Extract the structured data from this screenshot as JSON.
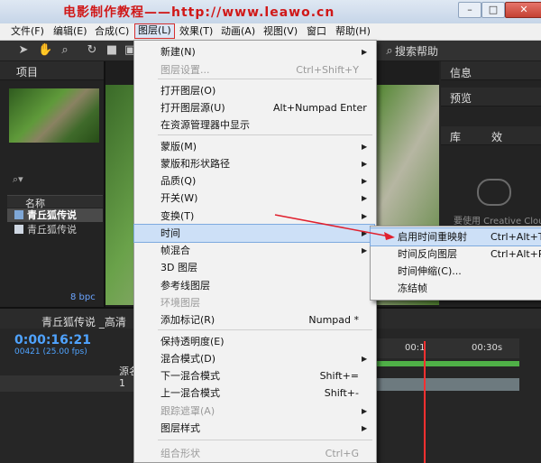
{
  "watermark": "电影制作教程——http://www.leawo.cn",
  "window_buttons": {
    "minimize": "–",
    "maximize": "□",
    "close": "✕"
  },
  "menubar": [
    "文件(F)",
    "编辑(E)",
    "合成(C)",
    "图层(L)",
    "效果(T)",
    "动画(A)",
    "视图(V)",
    "窗口",
    "帮助(H)"
  ],
  "toolbar": {
    "search_help": "搜索帮助"
  },
  "project_panel": {
    "tab": "项目",
    "column_name": "名称",
    "items": [
      "青丘狐传说",
      "青丘狐传说"
    ],
    "bpc": "8 bpc"
  },
  "right_panels": {
    "info": "信息",
    "preview": "预览",
    "library": "库",
    "effects": "效",
    "cc_text": "要使用 Creative Cloud"
  },
  "timeline": {
    "comp_tab": "青丘狐传说 _高清",
    "timecode": "0:00:16:21",
    "fps": "00421 (25.00 fps)",
    "col_source": "源名",
    "ruler_marks": [
      "00:1",
      "00:30s"
    ],
    "layer_index": "1"
  },
  "layer_menu": {
    "items": [
      {
        "label": "新建(N)",
        "shortcut": "",
        "submenu": true,
        "disabled": false
      },
      {
        "label": "图层设置...",
        "shortcut": "Ctrl+Shift+Y",
        "submenu": false,
        "disabled": true
      },
      {
        "label": "打开图层(O)",
        "shortcut": "",
        "submenu": false,
        "disabled": false
      },
      {
        "label": "打开图层源(U)",
        "shortcut": "Alt+Numpad Enter",
        "submenu": false,
        "disabled": false
      },
      {
        "label": "在资源管理器中显示",
        "shortcut": "",
        "submenu": false,
        "disabled": false
      },
      {
        "label": "蒙版(M)",
        "shortcut": "",
        "submenu": true,
        "disabled": false
      },
      {
        "label": "蒙版和形状路径",
        "shortcut": "",
        "submenu": true,
        "disabled": false
      },
      {
        "label": "品质(Q)",
        "shortcut": "",
        "submenu": true,
        "disabled": false
      },
      {
        "label": "开关(W)",
        "shortcut": "",
        "submenu": true,
        "disabled": false
      },
      {
        "label": "变换(T)",
        "shortcut": "",
        "submenu": true,
        "disabled": false
      },
      {
        "label": "时间",
        "shortcut": "",
        "submenu": true,
        "disabled": false,
        "highlighted": true
      },
      {
        "label": "帧混合",
        "shortcut": "",
        "submenu": true,
        "disabled": false
      },
      {
        "label": "3D 图层",
        "shortcut": "",
        "submenu": false,
        "disabled": false
      },
      {
        "label": "参考线图层",
        "shortcut": "",
        "submenu": false,
        "disabled": false
      },
      {
        "label": "环境图层",
        "shortcut": "",
        "submenu": false,
        "disabled": true
      },
      {
        "label": "添加标记(R)",
        "shortcut": "Numpad *",
        "submenu": false,
        "disabled": false
      },
      {
        "label": "保持透明度(E)",
        "shortcut": "",
        "submenu": false,
        "disabled": false
      },
      {
        "label": "混合模式(D)",
        "shortcut": "",
        "submenu": true,
        "disabled": false
      },
      {
        "label": "下一混合模式",
        "shortcut": "Shift+=",
        "submenu": false,
        "disabled": false
      },
      {
        "label": "上一混合模式",
        "shortcut": "Shift+-",
        "submenu": false,
        "disabled": false
      },
      {
        "label": "跟踪遮罩(A)",
        "shortcut": "",
        "submenu": true,
        "disabled": true
      },
      {
        "label": "图层样式",
        "shortcut": "",
        "submenu": true,
        "disabled": false
      },
      {
        "label": "组合形状",
        "shortcut": "Ctrl+G",
        "submenu": false,
        "disabled": true
      }
    ]
  },
  "time_submenu": {
    "items": [
      {
        "label": "启用时间重映射",
        "shortcut": "Ctrl+Alt+T",
        "highlighted": true
      },
      {
        "label": "时间反向图层",
        "shortcut": "Ctrl+Alt+R"
      },
      {
        "label": "时间伸缩(C)...",
        "shortcut": ""
      },
      {
        "label": "冻结帧",
        "shortcut": ""
      }
    ]
  },
  "colors": {
    "accent_red": "#d6302f",
    "timecode_blue": "#4fa3ff",
    "highlight": "#cde0f7"
  }
}
